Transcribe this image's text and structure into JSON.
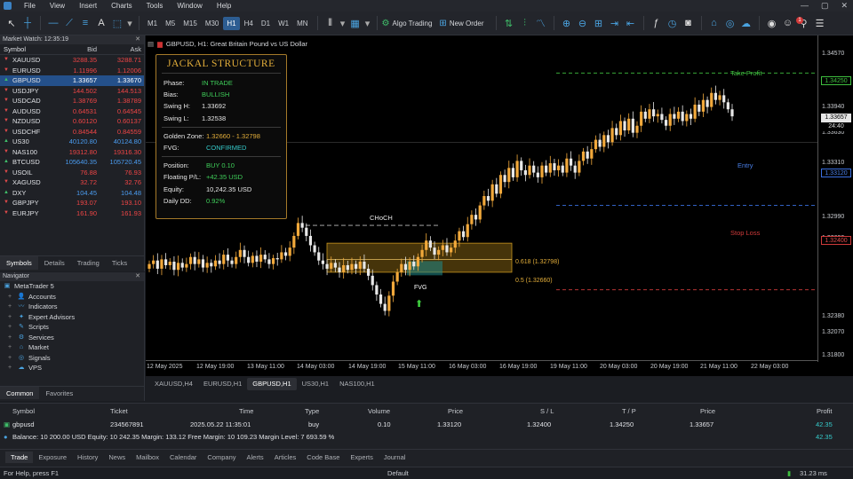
{
  "menu": [
    "File",
    "View",
    "Insert",
    "Charts",
    "Tools",
    "Window",
    "Help"
  ],
  "toolbar": {
    "timeframes": [
      "M1",
      "M5",
      "M15",
      "M30",
      "H1",
      "H4",
      "D1",
      "W1",
      "MN"
    ],
    "active_timeframe": "H1",
    "algo_trading": "Algo Trading",
    "new_order": "New Order",
    "notifications_count": "1"
  },
  "market_watch": {
    "title": "Market Watch: 12:35:19",
    "col_symbol": "Symbol",
    "col_bid": "Bid",
    "col_ask": "Ask",
    "rows": [
      {
        "symbol": "XAUUSD",
        "bid": "3288.35",
        "ask": "3288.71",
        "dir": "down"
      },
      {
        "symbol": "EURUSD",
        "bid": "1.11996",
        "ask": "1.12006",
        "dir": "down"
      },
      {
        "symbol": "GBPUSD",
        "bid": "1.33657",
        "ask": "1.33670",
        "dir": "up"
      },
      {
        "symbol": "USDJPY",
        "bid": "144.502",
        "ask": "144.513",
        "dir": "down"
      },
      {
        "symbol": "USDCAD",
        "bid": "1.38769",
        "ask": "1.38789",
        "dir": "down"
      },
      {
        "symbol": "AUDUSD",
        "bid": "0.64531",
        "ask": "0.64545",
        "dir": "down"
      },
      {
        "symbol": "NZDUSD",
        "bid": "0.60120",
        "ask": "0.60137",
        "dir": "down"
      },
      {
        "symbol": "USDCHF",
        "bid": "0.84544",
        "ask": "0.84559",
        "dir": "down"
      },
      {
        "symbol": "US30",
        "bid": "40120.80",
        "ask": "40124.80",
        "dir": "up"
      },
      {
        "symbol": "NAS100",
        "bid": "19312.80",
        "ask": "19316.30",
        "dir": "down"
      },
      {
        "symbol": "BTCUSD",
        "bid": "105640.35",
        "ask": "105720.45",
        "dir": "up"
      },
      {
        "symbol": "USOIL",
        "bid": "76.88",
        "ask": "76.93",
        "dir": "down"
      },
      {
        "symbol": "XAGUSD",
        "bid": "32.72",
        "ask": "32.76",
        "dir": "down"
      },
      {
        "symbol": "DXY",
        "bid": "104.45",
        "ask": "104.48",
        "dir": "up"
      },
      {
        "symbol": "GBPJPY",
        "bid": "193.07",
        "ask": "193.10",
        "dir": "down"
      },
      {
        "symbol": "EURJPY",
        "bid": "161.90",
        "ask": "161.93",
        "dir": "down"
      }
    ],
    "selected_symbol": "GBPUSD",
    "tabs": [
      "Symbols",
      "Details",
      "Trading",
      "Ticks"
    ],
    "active_tab": "Symbols"
  },
  "navigator": {
    "title": "Navigator",
    "root": "MetaTrader 5",
    "items": [
      "Accounts",
      "Indicators",
      "Expert Advisors",
      "Scripts",
      "Services",
      "Market",
      "Signals",
      "VPS"
    ],
    "tabs": [
      "Common",
      "Favorites"
    ],
    "active_tab": "Common"
  },
  "chart": {
    "title": "GBPUSD, H1: Great Britain Pound vs US Dollar",
    "panel": {
      "title": "JACKAL STRUCTURE",
      "phase_k": "Phase:",
      "phase_v": "IN TRADE",
      "bias_k": "Bias:",
      "bias_v": "BULLISH",
      "swing_h_k": "Swing H:",
      "swing_h_v": "1.33692",
      "swing_l_k": "Swing L:",
      "swing_l_v": "1.32538",
      "golden_k": "Golden Zone:",
      "golden_v": "1.32660 - 1.32798",
      "fvg_k": "FVG:",
      "fvg_v": "CONFIRMED",
      "position_k": "Position:",
      "position_v": "BUY 0.10",
      "floating_k": "Floating P/L:",
      "floating_v": "+42.35 USD",
      "equity_k": "Equity:",
      "equity_v": "10,242.35 USD",
      "daily_dd_k": "Daily DD:",
      "daily_dd_v": "0.92%"
    },
    "choch_label": "CHoCH",
    "fib_618": "0.618 (1.32798)",
    "fib_5": "0.5 (1.32660)",
    "fvg_label": "FVG",
    "take_profit_label": "Take Profit",
    "entry_label": "Entry",
    "stop_loss_label": "Stop Loss",
    "price_labels": [
      "1.34570",
      "1.34250",
      "1.33940",
      "1.33657",
      "24:40",
      "1.33630",
      "1.33310",
      "1.33120",
      "1.32990",
      "1.32690",
      "1.32400",
      "1.32380",
      "1.32070",
      "1.31800"
    ],
    "tag_take_profit": "1.34250",
    "tag_bid": "1.33657",
    "tag_timer": "24:40",
    "tag_entry": "1.33120",
    "tag_stop": "1.32400",
    "time_labels": [
      "12 May 2025",
      "12 May 19:00",
      "13 May 11:00",
      "14 May 03:00",
      "14 May 19:00",
      "15 May 11:00",
      "16 May 03:00",
      "16 May 19:00",
      "19 May 11:00",
      "20 May 03:00",
      "20 May 19:00",
      "21 May 11:00",
      "22 May 03:00"
    ],
    "colors": {
      "bull": "#f2a93b",
      "bear": "#e8e8e8",
      "tp": "#3fbf3f",
      "entry": "#3a6fe0",
      "sl": "#d03a3a",
      "zone": "#c8961e"
    }
  },
  "chart_data": {
    "type": "candlestick",
    "symbol": "GBPUSD",
    "timeframe": "H1",
    "x_range": [
      "12 May 2025",
      "22 May 03:00"
    ],
    "ylim": [
      1.318,
      1.3457
    ],
    "levels": {
      "take_profit": 1.3425,
      "entry": 1.3312,
      "stop_loss": 1.324,
      "current_bid": 1.33657,
      "fib_0_618": 1.32798,
      "fib_0_5": 1.3266,
      "choch": 1.3298
    },
    "close_path": [
      1.3262,
      1.3265,
      1.3258,
      1.3266,
      1.3261,
      1.3264,
      1.3257,
      1.3263,
      1.3259,
      1.3262,
      1.3268,
      1.3262,
      1.3266,
      1.3259,
      1.3263,
      1.326,
      1.3265,
      1.3262,
      1.327,
      1.3265,
      1.3262,
      1.3268,
      1.3274,
      1.3268,
      1.3263,
      1.3269,
      1.3264,
      1.327,
      1.3266,
      1.3262,
      1.3267,
      1.3266,
      1.3272,
      1.3269,
      1.3276,
      1.3286,
      1.3297,
      1.3293,
      1.3286,
      1.3278,
      1.3272,
      1.3265,
      1.3262,
      1.3258,
      1.3263,
      1.3259,
      1.3255,
      1.3261,
      1.3257,
      1.3262,
      1.3258,
      1.3264,
      1.3258,
      1.3252,
      1.3244,
      1.3236,
      1.3228,
      1.3222,
      1.3235,
      1.3247,
      1.3255,
      1.3262,
      1.3257,
      1.3264,
      1.326,
      1.3268,
      1.3274,
      1.3282,
      1.3276,
      1.327,
      1.3274,
      1.3278,
      1.3272,
      1.3276,
      1.3282,
      1.329,
      1.3285,
      1.3296,
      1.3304,
      1.33,
      1.3312,
      1.332,
      1.3316,
      1.333,
      1.3322,
      1.3338,
      1.3332,
      1.3344,
      1.3336,
      1.335,
      1.3342,
      1.3338,
      1.3346,
      1.334,
      1.3336,
      1.3346,
      1.334,
      1.3348,
      1.3342,
      1.3346,
      1.334,
      1.3352,
      1.3346,
      1.334,
      1.335,
      1.3358,
      1.3352,
      1.336,
      1.3368,
      1.3362,
      1.3372,
      1.3366,
      1.3378,
      1.3372,
      1.3384,
      1.3376,
      1.3386,
      1.3374,
      1.338,
      1.3392,
      1.3386,
      1.3394,
      1.3388,
      1.339,
      1.3385,
      1.338,
      1.339,
      1.3386,
      1.3392,
      1.3384,
      1.339,
      1.3386,
      1.3398,
      1.3392,
      1.3402,
      1.3396,
      1.3408,
      1.3402,
      1.3406,
      1.34,
      1.3394,
      1.3388
    ]
  },
  "chart_tabs": [
    "XAUUSD,H4",
    "EURUSD,H1",
    "GBPUSD,H1",
    "US30,H1",
    "NAS100,H1"
  ],
  "active_chart_tab": "GBPUSD,H1",
  "trade": {
    "headers": {
      "symbol": "Symbol",
      "ticket": "Ticket",
      "time": "Time",
      "type": "Type",
      "volume": "Volume",
      "price": "Price",
      "sl": "S / L",
      "tp": "T / P",
      "price2": "Price",
      "profit": "Profit"
    },
    "row": {
      "symbol": "gbpusd",
      "ticket": "234567891",
      "time": "2025.05.22 11:35:01",
      "type": "buy",
      "volume": "0.10",
      "price": "1.33120",
      "sl": "1.32400",
      "tp": "1.34250",
      "price2": "1.33657",
      "profit": "42.35"
    },
    "balance_line": "Balance: 10 200.00 USD   Equity: 10 242.35   Margin: 133.12   Free Margin: 10 109.23   Margin Level: 7 693.59 %",
    "balance_profit": "42.35",
    "tabs": [
      "Trade",
      "Exposure",
      "History",
      "News",
      "Mailbox",
      "Calendar",
      "Company",
      "Alerts",
      "Articles",
      "Code Base",
      "Experts",
      "Journal"
    ],
    "active_tab": "Trade"
  },
  "status": {
    "help": "For Help, press F1",
    "profile": "Default",
    "ping": "31.23 ms"
  }
}
